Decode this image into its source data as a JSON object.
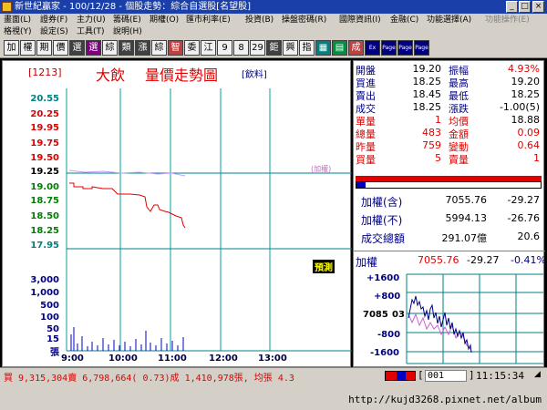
{
  "titlebar": {
    "title": "新世紀贏家 - 100/12/28 - 個股走勢：綜合自選股[名望股]"
  },
  "menubar": {
    "row1": [
      "畫面(L)",
      "證券(F)",
      "主力(U)",
      "籌碼(E)",
      "期權(O)",
      "匯市利率(E)",
      "投資(B)",
      "操盤密碼(R)",
      "國際資訊(I)",
      "金融(C)",
      "功能選擇(A)",
      "功能操作(E)"
    ],
    "row2": [
      "格視(Y)",
      "設定(S)",
      "工具(T)",
      "說明(H)"
    ]
  },
  "toolbar": {
    "buttons": [
      "加",
      "權",
      "期",
      "價",
      "選",
      "選",
      "綜",
      "類",
      "漲",
      "綜",
      "智",
      "委",
      "江",
      "9",
      "8",
      "29",
      "鉅",
      "興",
      "指",
      "",
      "",
      "成",
      "Ex",
      "Page",
      "Page",
      "Page"
    ]
  },
  "chart": {
    "stock_code": "[1213]",
    "stock_name": "大飲",
    "chart_title": "量價走勢圖",
    "category": "[飲料]",
    "weighted_note": "(加權)",
    "forecast_badge": "預測",
    "y_labels": [
      "20.55",
      "20.25",
      "19.95",
      "19.75",
      "19.50",
      "19.25",
      "19.00",
      "18.75",
      "18.50",
      "18.25",
      "17.95"
    ],
    "vol_labels": [
      "3,000",
      "1,000",
      "500",
      "100",
      "50",
      "15",
      "張"
    ],
    "x_labels": [
      "9:00",
      "10:00",
      "11:00",
      "12:00",
      "13:00"
    ]
  },
  "quote": {
    "rows": [
      {
        "l1": "開盤",
        "v1": "19.20",
        "l2": "振幅",
        "v2": "4.93%",
        "c1": "#000000",
        "c2": "#e00000"
      },
      {
        "l1": "買進",
        "v1": "18.25",
        "l2": "最高",
        "v2": "19.20",
        "c1": "#000000",
        "c2": "#000000"
      },
      {
        "l1": "賣出",
        "v1": "18.45",
        "l2": "最低",
        "v2": "18.25",
        "c1": "#000000",
        "c2": "#000000"
      },
      {
        "l1": "成交",
        "v1": "18.25",
        "l2": "漲跌",
        "v2": "-1.00(5)",
        "c1": "#000000",
        "c2": "#000000"
      },
      {
        "l1": "單量",
        "v1": "1",
        "l2": "均價",
        "v2": "18.88",
        "c1": "#e00000",
        "c2": "#000000"
      },
      {
        "l1": "總量",
        "v1": "483",
        "l2": "金額",
        "v2": "0.09",
        "c1": "#e00000",
        "c2": "#e00000"
      },
      {
        "l1": "昨量",
        "v1": "759",
        "l2": "變動",
        "v2": "0.64",
        "c1": "#e00000",
        "c2": "#e00000"
      },
      {
        "l1": "買量",
        "v1": "5",
        "l2": "賣量",
        "v2": "1",
        "c1": "#e00000",
        "c2": "#e00000"
      }
    ],
    "index_rows": [
      {
        "label": "加權(含)",
        "value": "7055.76",
        "change": "-29.27"
      },
      {
        "label": "加權(不)",
        "value": "5994.13",
        "change": "-26.76"
      },
      {
        "label": "成交總額",
        "value": "291.07億",
        "change": "20.6"
      }
    ],
    "mini": {
      "label": "加權",
      "value": "7055.76",
      "change": "-29.27",
      "pct": "-0.41%",
      "y_labels": [
        "+1600",
        "+800",
        "7085",
        "-800",
        "-1600"
      ],
      "y_mid_suffix": "03"
    }
  },
  "statusbar": {
    "ticker": "買 9,315,304賣 6,798,664( 0.73)成 1,410,978張, 均張 4.3",
    "code_input": "001",
    "time": "11:15:34"
  },
  "url": "http://kujd3268.pixnet.net/album",
  "colors": {
    "price_line": "#e00000",
    "avg_line": "#c0a0ff",
    "ref_line": "#008080",
    "grid": "#00a0a0",
    "volume": "#0000c0"
  }
}
